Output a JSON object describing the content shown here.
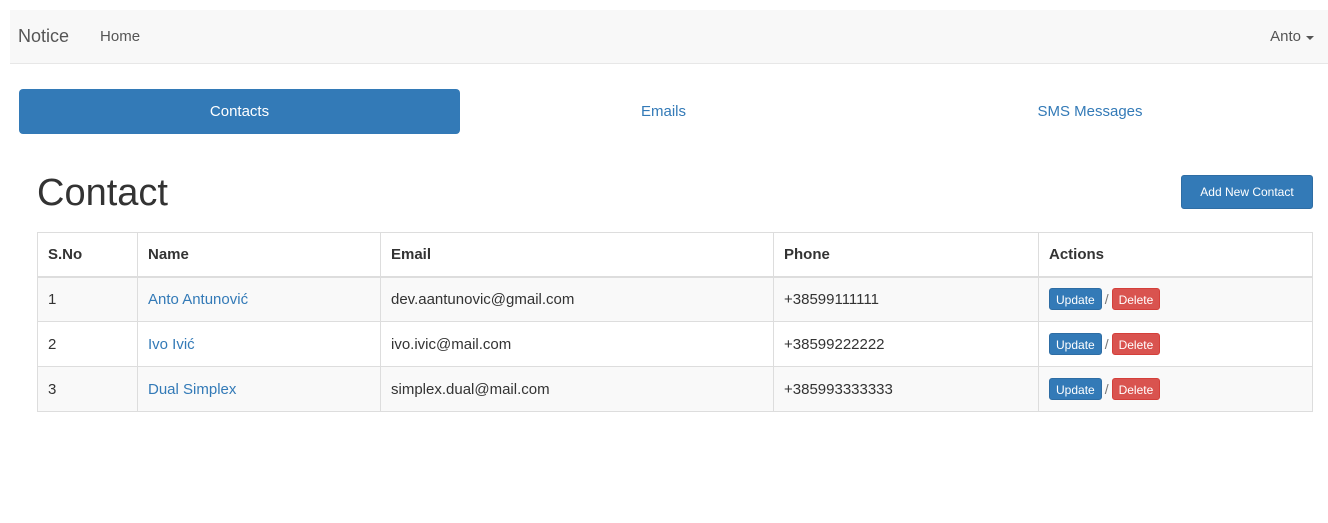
{
  "navbar": {
    "brand": "Notice",
    "home": "Home",
    "user": "Anto"
  },
  "tabs": [
    {
      "label": "Contacts",
      "active": true
    },
    {
      "label": "Emails",
      "active": false
    },
    {
      "label": "SMS Messages",
      "active": false
    }
  ],
  "page": {
    "title": "Contact",
    "add_button": "Add New Contact"
  },
  "table": {
    "headers": [
      "S.No",
      "Name",
      "Email",
      "Phone",
      "Actions"
    ],
    "rows": [
      {
        "sno": "1",
        "name": "Anto Antunović",
        "email": "dev.aantunovic@gmail.com",
        "phone": "+38599111111"
      },
      {
        "sno": "2",
        "name": "Ivo Ivić",
        "email": "ivo.ivic@mail.com",
        "phone": "+38599222222"
      },
      {
        "sno": "3",
        "name": "Dual Simplex",
        "email": "simplex.dual@mail.com",
        "phone": "+385993333333"
      }
    ],
    "update_label": "Update",
    "delete_label": "Delete",
    "separator": "/"
  },
  "colors": {
    "primary": "#337ab7",
    "danger": "#d9534f",
    "navbar_bg": "#f8f8f8"
  },
  "icons": {
    "user_menu": "caret-down-icon"
  }
}
